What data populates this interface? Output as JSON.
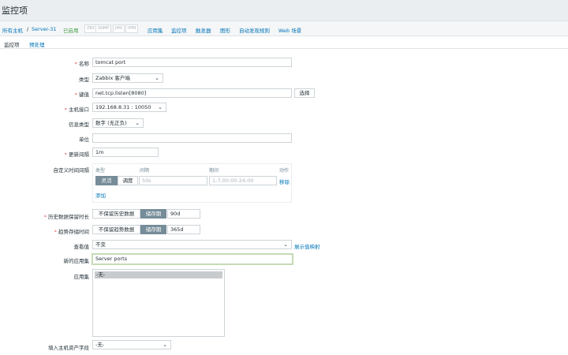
{
  "page": {
    "title": "监控项"
  },
  "breadcrumb": {
    "all_hosts": "所有主机",
    "separator": "/",
    "host": "Server-31",
    "status": "已启用",
    "tags": [
      "ZBX",
      "SNMP",
      "JMX",
      "IPMI"
    ],
    "links": [
      "应用集",
      "监控项",
      "触发器",
      "图形",
      "自动发现规则",
      "Web 场景"
    ]
  },
  "tabs": [
    "监控项",
    "预处理"
  ],
  "form": {
    "name": {
      "label": "名称",
      "value": "tomcat port"
    },
    "type": {
      "label": "类型",
      "value": "Zabbix 客户端"
    },
    "key": {
      "label": "键值",
      "value": "net.tcp.listen[8080]",
      "button": "选择"
    },
    "interface": {
      "label": "主机接口",
      "value": "192.168.8.31 : 10050"
    },
    "info_type": {
      "label": "信息类型",
      "value": "数字 (无正负)"
    },
    "units": {
      "label": "单位",
      "value": ""
    },
    "update_interval": {
      "label": "更新间隔",
      "value": "1m"
    },
    "custom_intervals": {
      "label": "自定义时间间隔",
      "headers": [
        "类型",
        "间隔",
        "期间",
        "动作"
      ],
      "row": {
        "type_flexible": "灵活",
        "type_scheduling": "调度",
        "interval_placeholder": "50s",
        "period_placeholder": "1-7,00:00-24:00",
        "action": "移除"
      },
      "add": "添加"
    },
    "history": {
      "label": "历史数据保留时长",
      "options": [
        "不保留历史数据",
        "储存期"
      ],
      "value": "90d"
    },
    "trends": {
      "label": "趋势存储时间",
      "options": [
        "不保留趋势数据",
        "储存期"
      ],
      "value": "365d"
    },
    "valuemap": {
      "label": "查看值",
      "value": "不变",
      "link": "展示值映射"
    },
    "new_application": {
      "label": "新的应用集",
      "value": "Server ports"
    },
    "applications": {
      "label": "应用集",
      "options": [
        "-无-"
      ]
    },
    "inventory": {
      "label": "填入主机资产字段",
      "value": "-无-"
    }
  }
}
